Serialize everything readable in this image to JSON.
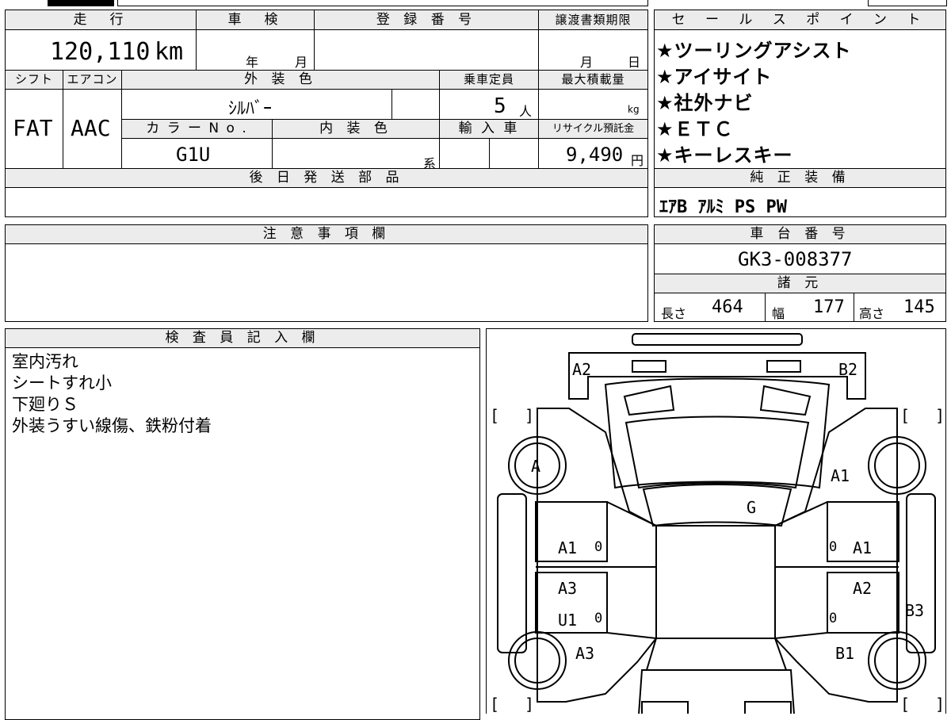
{
  "top": {
    "mileage_header": "走　行",
    "mileage_value": "120,110",
    "mileage_unit": "km",
    "inspection_header": "車　検",
    "inspection_year": "年",
    "inspection_month": "月",
    "registration_header": "登 録 番 号",
    "transfer_header": "譲渡書類期限",
    "transfer_month": "月",
    "transfer_day": "日",
    "shift_header": "シフト",
    "aircon_header": "エアコン",
    "exterior_header": "外 装 色",
    "capacity_header": "乗車定員",
    "load_header": "最大積載量",
    "shift_value": "FAT",
    "aircon_value": "AAC",
    "exterior_value": "ｼﾙﾊﾞｰ",
    "capacity_value": "5",
    "capacity_unit": "人",
    "load_unit": "kg",
    "color_no_header": "カ ラ ー N o .",
    "interior_header": "内 装 色",
    "import_header": "輸 入 車",
    "recycle_header": "リサイクル預託金",
    "color_no_value": "G1U",
    "interior_unit": "系",
    "recycle_value": "9,490",
    "recycle_unit": "円",
    "later_parts_header": "後 日 発 送 部 品"
  },
  "sales": {
    "header": "セ ー ル ス ポ イ ン ト",
    "points": [
      "★ツーリングアシスト",
      "★アイサイト",
      "★社外ナビ",
      "★ＥＴＣ",
      "★キーレスキー"
    ]
  },
  "equipment": {
    "header": "純 正 装 備",
    "value": "ｴｱB ｱﾙﾐ PS PW"
  },
  "caution": {
    "header": "注 意 事 項 欄"
  },
  "chassis": {
    "header": "車 台 番 号",
    "value": "GK3-008377"
  },
  "specs": {
    "header": "諸 元",
    "length_label": "長さ",
    "length_value": "464",
    "width_label": "幅",
    "width_value": "177",
    "height_label": "高さ",
    "height_value": "145"
  },
  "inspector": {
    "header": "検 査 員 記 入 欄",
    "notes": [
      "室内汚れ",
      "シートすれ小",
      "下廻りＳ",
      "外装うすい線傷、鉄粉付着"
    ]
  },
  "diagram": {
    "marks": [
      "A2",
      "B2",
      "A",
      "A1",
      "G",
      "A1",
      "A1",
      "A3",
      "U1",
      "A2",
      "B3",
      "A3",
      "B1"
    ],
    "zero": "0",
    "bracket_open": "[",
    "bracket_close": "]"
  }
}
